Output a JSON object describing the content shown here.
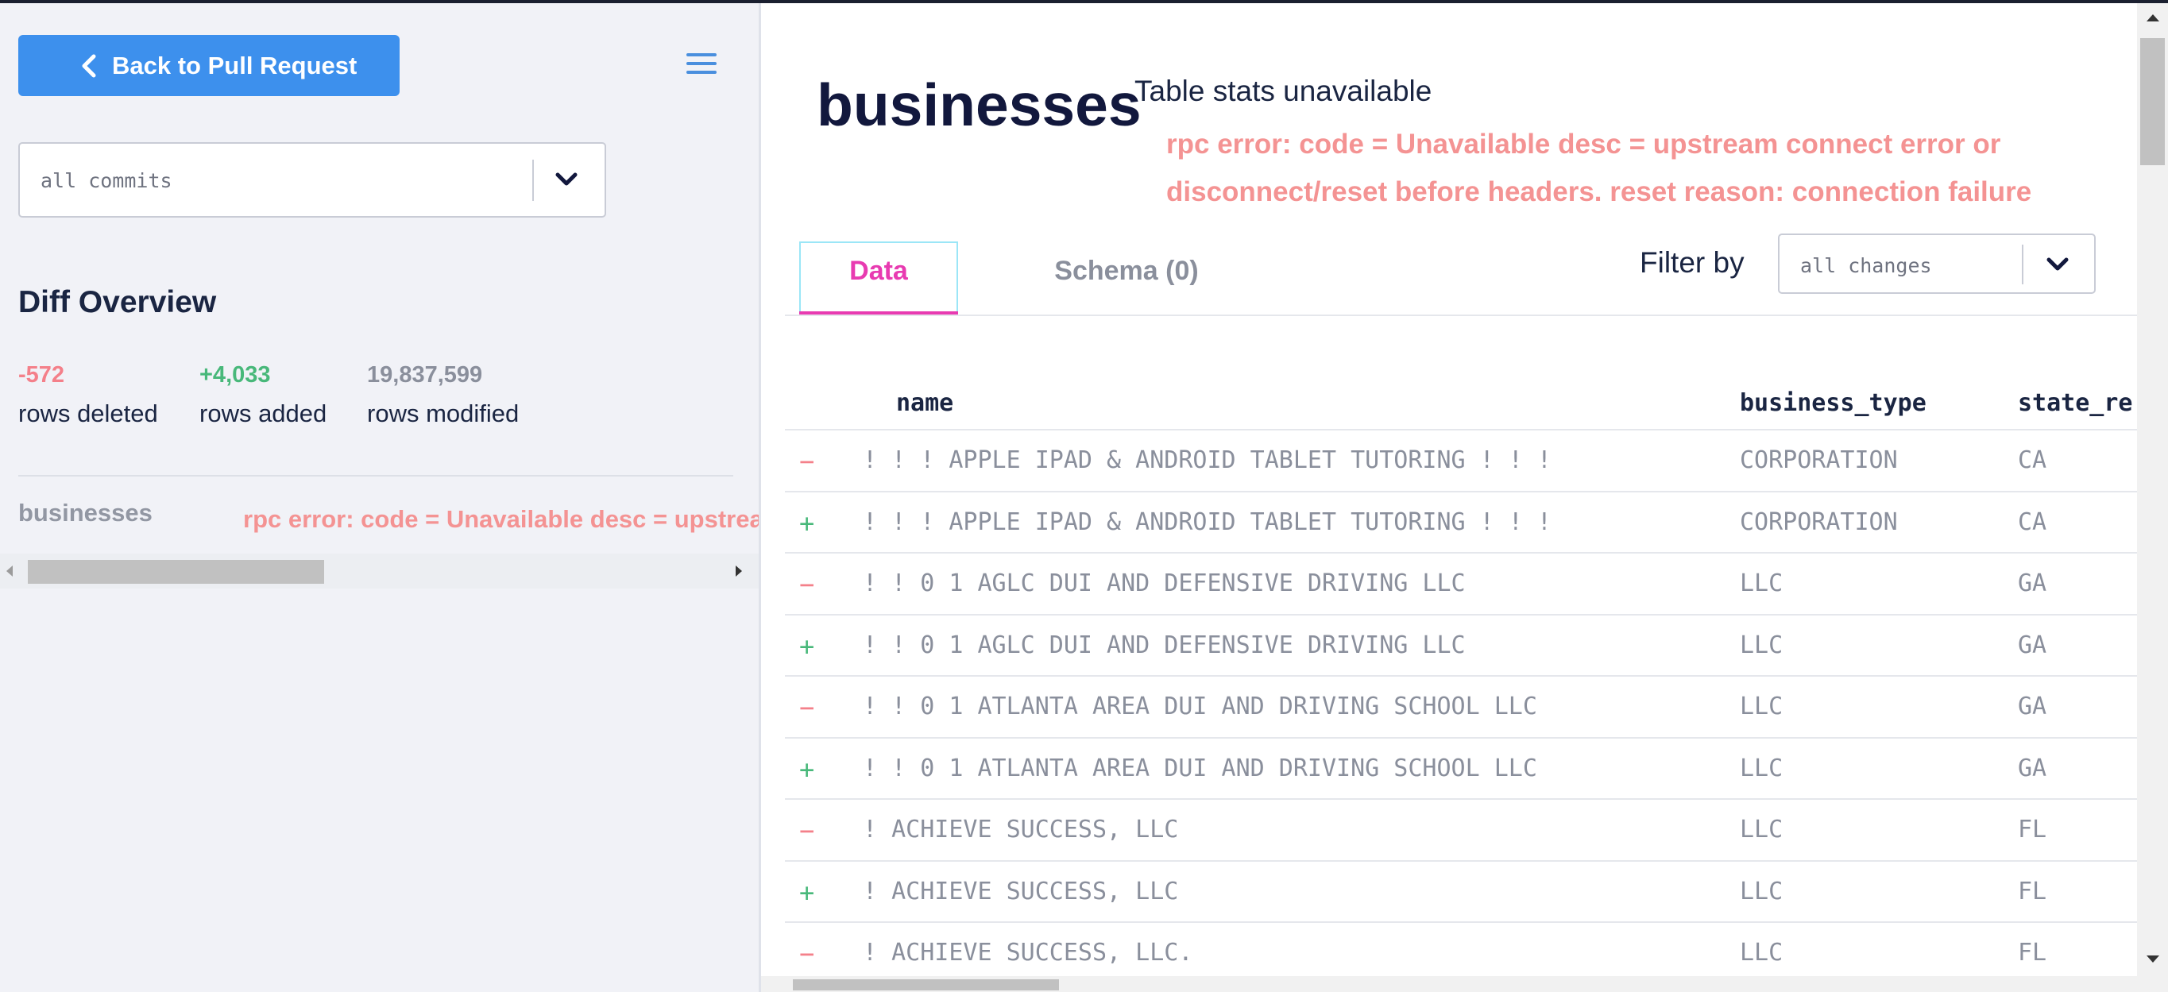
{
  "sidebar": {
    "back_button_label": "Back to Pull Request",
    "commit_filter_value": "all commits",
    "diff_overview_title": "Diff Overview",
    "stats": [
      {
        "value": "-572",
        "label": "rows deleted",
        "color": "#f4808a"
      },
      {
        "value": "+4,033",
        "label": "rows added",
        "color": "#48b87a"
      },
      {
        "value": "19,837,599",
        "label": "rows modified",
        "color": "#8a8f9c"
      }
    ],
    "table_name": "businesses",
    "table_error": "rpc error: code = Unavailable desc = upstrea"
  },
  "main": {
    "title": "businesses",
    "stats_status": "Table stats unavailable",
    "error_message": "rpc error: code = Unavailable desc = upstream connect error or disconnect/reset before headers. reset reason: connection failure",
    "tabs": [
      {
        "label": "Data",
        "active": true
      },
      {
        "label": "Schema (0)",
        "active": false
      }
    ],
    "filter_label": "Filter by",
    "filter_value": "all changes",
    "columns": [
      "name",
      "business_type",
      "state_re"
    ],
    "rows": [
      {
        "sign": "−",
        "type": "removed",
        "name": "! ! ! APPLE IPAD & ANDROID TABLET TUTORING ! ! !",
        "business_type": "CORPORATION",
        "state": "CA"
      },
      {
        "sign": "+",
        "type": "added",
        "name": "! ! ! APPLE IPAD & ANDROID TABLET TUTORING ! ! !",
        "business_type": "CORPORATION",
        "state": "CA"
      },
      {
        "sign": "−",
        "type": "removed",
        "name": "! ! 0 1 AGLC DUI AND DEFENSIVE DRIVING LLC",
        "business_type": "LLC",
        "state": "GA"
      },
      {
        "sign": "+",
        "type": "added",
        "name": "! ! 0 1 AGLC DUI AND DEFENSIVE DRIVING LLC",
        "business_type": "LLC",
        "state": "GA"
      },
      {
        "sign": "−",
        "type": "removed",
        "name": "! ! 0 1 ATLANTA AREA DUI AND DRIVING SCHOOL LLC",
        "business_type": "LLC",
        "state": "GA"
      },
      {
        "sign": "+",
        "type": "added",
        "name": "! ! 0 1 ATLANTA AREA DUI AND DRIVING SCHOOL LLC",
        "business_type": "LLC",
        "state": "GA"
      },
      {
        "sign": "−",
        "type": "removed",
        "name": "! ACHIEVE SUCCESS, LLC",
        "business_type": "LLC",
        "state": "FL"
      },
      {
        "sign": "+",
        "type": "added",
        "name": "! ACHIEVE SUCCESS, LLC",
        "business_type": "LLC",
        "state": "FL"
      },
      {
        "sign": "−",
        "type": "removed",
        "name": "! ACHIEVE SUCCESS, LLC.",
        "business_type": "LLC",
        "state": "FL"
      }
    ]
  },
  "colors": {
    "accent": "#3d90ed",
    "active_tab": "#e83bb1",
    "removed": "#f4808a",
    "added": "#48b87a",
    "error": "#f49393"
  },
  "icons": [
    "chevron-left-icon",
    "menu-icon",
    "chevron-down-icon",
    "scroll-arrow-left-icon",
    "scroll-arrow-right-icon"
  ]
}
